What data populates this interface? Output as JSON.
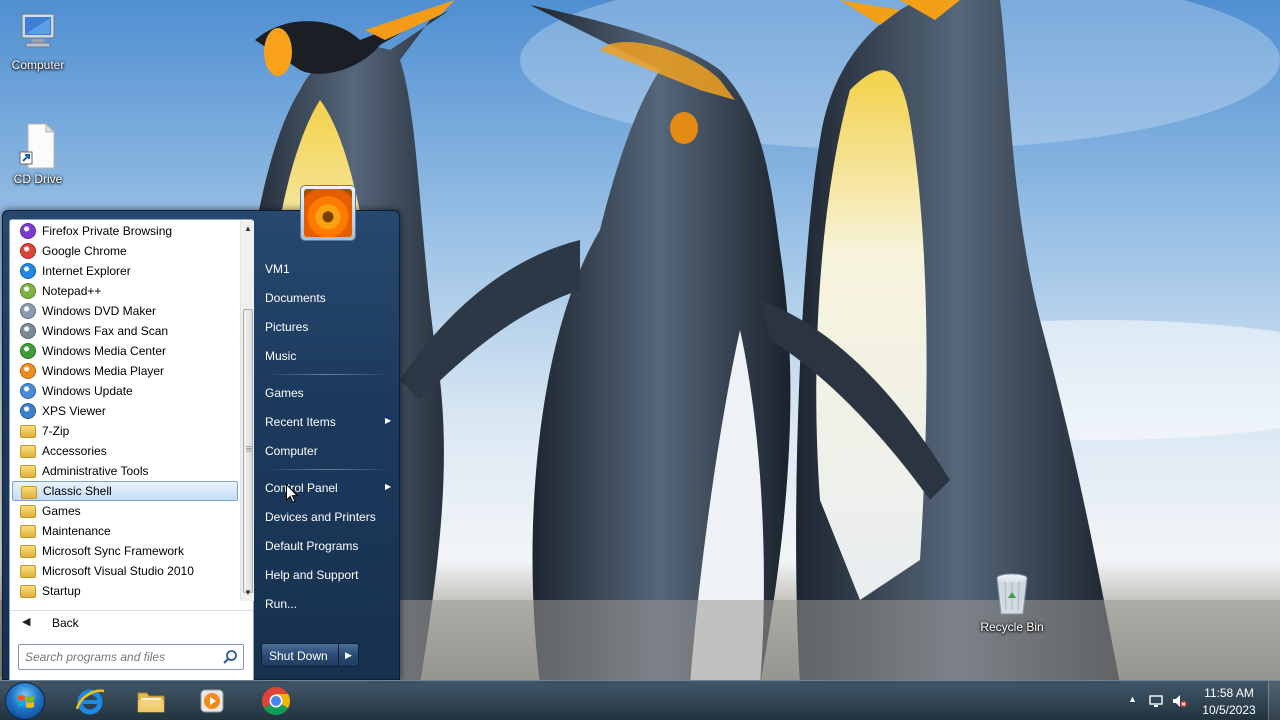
{
  "desktop": {
    "icons": [
      {
        "label": "Computer"
      },
      {
        "label": "CD Drive"
      },
      {
        "label": "Recycle Bin"
      }
    ]
  },
  "start_menu": {
    "programs": [
      {
        "label": "Firefox Private Browsing",
        "icon": "firefox-private-icon",
        "color": "#7d3ad1"
      },
      {
        "label": "Google Chrome",
        "icon": "chrome-icon",
        "color": "#db4437"
      },
      {
        "label": "Internet Explorer",
        "icon": "internet-explorer-icon",
        "color": "#1e88e5"
      },
      {
        "label": "Notepad++",
        "icon": "notepad-plus-plus-icon",
        "color": "#7cb342"
      },
      {
        "label": "Windows DVD Maker",
        "icon": "dvd-maker-icon",
        "color": "#8a9ab0"
      },
      {
        "label": "Windows Fax and Scan",
        "icon": "fax-scan-icon",
        "color": "#7a8a99"
      },
      {
        "label": "Windows Media Center",
        "icon": "media-center-icon",
        "color": "#3f9b3a"
      },
      {
        "label": "Windows Media Player",
        "icon": "media-player-icon",
        "color": "#f08c1b"
      },
      {
        "label": "Windows Update",
        "icon": "windows-update-icon",
        "color": "#4a8bd4"
      },
      {
        "label": "XPS Viewer",
        "icon": "xps-viewer-icon",
        "color": "#3a7fc9"
      },
      {
        "label": "7-Zip",
        "icon": "folder-icon",
        "folder": true
      },
      {
        "label": "Accessories",
        "icon": "folder-icon",
        "folder": true
      },
      {
        "label": "Administrative Tools",
        "icon": "folder-icon",
        "folder": true
      },
      {
        "label": "Classic Shell",
        "icon": "folder-icon",
        "folder": true,
        "selected": true
      },
      {
        "label": "Games",
        "icon": "folder-icon",
        "folder": true
      },
      {
        "label": "Maintenance",
        "icon": "folder-icon",
        "folder": true
      },
      {
        "label": "Microsoft Sync Framework",
        "icon": "folder-icon",
        "folder": true
      },
      {
        "label": "Microsoft Visual Studio 2010",
        "icon": "folder-icon",
        "folder": true
      },
      {
        "label": "Startup",
        "icon": "folder-icon",
        "folder": true
      }
    ],
    "back_label": "Back",
    "search_placeholder": "Search programs and files",
    "places": {
      "user": "VM1",
      "documents": "Documents",
      "pictures": "Pictures",
      "music": "Music",
      "games": "Games",
      "recent_items": "Recent Items",
      "computer": "Computer",
      "control_panel": "Control Panel",
      "devices_printers": "Devices and Printers",
      "default_programs": "Default Programs",
      "help_support": "Help and Support",
      "run": "Run..."
    },
    "shutdown_label": "Shut Down"
  },
  "taskbar": {
    "pinned": [
      {
        "name": "internet-explorer-icon"
      },
      {
        "name": "windows-explorer-icon"
      },
      {
        "name": "media-player-icon"
      },
      {
        "name": "chrome-icon"
      }
    ],
    "clock": {
      "time": "11:58 AM",
      "date": "10/5/2023"
    }
  },
  "colors": {
    "start_menu_bg": "#1c3a5e",
    "selection": "#c2dcf7",
    "taskbar": "#2a3b47"
  }
}
